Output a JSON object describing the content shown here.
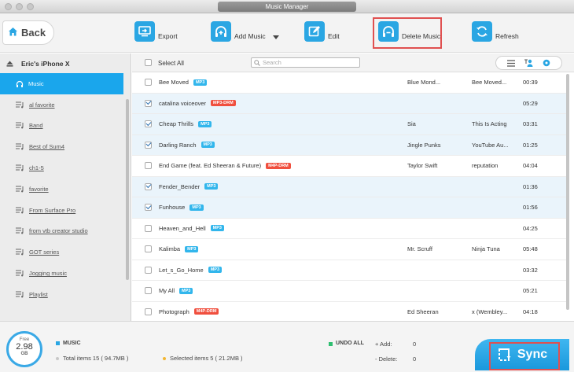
{
  "window": {
    "title": "Music Manager"
  },
  "toolbar": {
    "back_label": "Back",
    "export_label": "Export",
    "add_music_label": "Add Music",
    "edit_label": "Edit",
    "delete_music_label": "Delete Music",
    "refresh_label": "Refresh"
  },
  "sidebar": {
    "device_name": "Eric's iPhone X",
    "items": [
      {
        "label": "Music"
      },
      {
        "label": "al favorite"
      },
      {
        "label": "Band"
      },
      {
        "label": "Best of Sum4"
      },
      {
        "label": "ch1-5"
      },
      {
        "label": "favorite"
      },
      {
        "label": "From Surface Pro"
      },
      {
        "label": "from vtb creator studio"
      },
      {
        "label": "GOT series"
      },
      {
        "label": "Jogging music"
      },
      {
        "label": "Playlist"
      }
    ]
  },
  "list": {
    "select_all_label": "Select All",
    "search_placeholder": "Search",
    "rows": [
      {
        "name": "Bee Moved",
        "tag": "MP3",
        "artist": "Blue Mond...",
        "album": "Bee Moved...",
        "duration": "00:39",
        "checked": false
      },
      {
        "name": "catalina voiceover",
        "tag": "MP3-DRM",
        "artist": "",
        "album": "",
        "duration": "05:29",
        "checked": true
      },
      {
        "name": "Cheap Thrills",
        "tag": "MP3",
        "artist": "Sia",
        "album": "This Is Acting",
        "duration": "03:31",
        "checked": true
      },
      {
        "name": "Darling Ranch",
        "tag": "MP3",
        "artist": "Jingle Punks",
        "album": "YouTube Au...",
        "duration": "01:25",
        "checked": true
      },
      {
        "name": "End Game (feat. Ed Sheeran & Future)",
        "tag": "M4P-DRM",
        "artist": "Taylor Swift",
        "album": "reputation",
        "duration": "04:04",
        "checked": false
      },
      {
        "name": "Fender_Bender",
        "tag": "MP3",
        "artist": "",
        "album": "",
        "duration": "01:36",
        "checked": true
      },
      {
        "name": "Funhouse",
        "tag": "MP3",
        "artist": "",
        "album": "",
        "duration": "01:56",
        "checked": true
      },
      {
        "name": "Heaven_and_Hell",
        "tag": "MP3",
        "artist": "",
        "album": "",
        "duration": "04:25",
        "checked": false
      },
      {
        "name": "Kalimba",
        "tag": "MP3",
        "artist": "Mr. Scruff",
        "album": "Ninja Tuna",
        "duration": "05:48",
        "checked": false
      },
      {
        "name": "Let_s_Go_Home",
        "tag": "MP3",
        "artist": "",
        "album": "",
        "duration": "03:32",
        "checked": false
      },
      {
        "name": "My All",
        "tag": "MP3",
        "artist": "",
        "album": "",
        "duration": "05:21",
        "checked": false
      },
      {
        "name": "Photograph",
        "tag": "M4P-DRM",
        "artist": "Ed Sheeran",
        "album": "x (Wembley...",
        "duration": "04:18",
        "checked": false
      }
    ]
  },
  "storage": {
    "free_label": "Free",
    "value": "2.98",
    "unit": "GB"
  },
  "summary": {
    "category_label": "MUSIC",
    "total_items": "Total items 15 ( 94.7MB )",
    "selected_items": "Selected items 5 ( 21.2MB )",
    "undo_all_label": "UNDO ALL",
    "add_label": "+ Add:",
    "add_count": "0",
    "delete_label": "- Delete:",
    "delete_count": "0"
  },
  "sync": {
    "label": "Sync"
  },
  "colors": {
    "accent": "#1aa6ec",
    "highlight": "#e05050",
    "drm_tag": "#f04f3e",
    "mp3_tag": "#32b6ec"
  }
}
